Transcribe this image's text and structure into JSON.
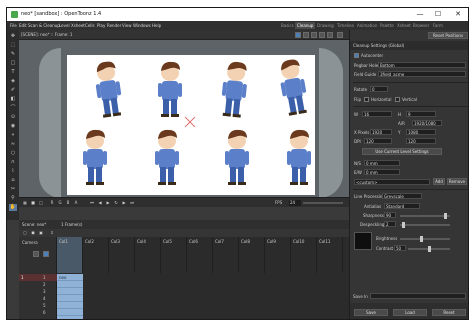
{
  "window": {
    "title": "neo* [sandbox] : OpenToonz 1.4",
    "min_glyph": "—",
    "max_glyph": "☐",
    "close_glyph": "✕"
  },
  "menubar": {
    "items": [
      "File",
      "Edit",
      "Scan & Cleanup",
      "Level",
      "Xsheet",
      "Cells",
      "Play",
      "Render",
      "View",
      "Windows",
      "Help"
    ],
    "rooms": [
      "Basics",
      "Cleanup",
      "Drawing",
      "Timeline",
      "Animation",
      "Palette",
      "Xsheet",
      "Browser",
      "Farm"
    ],
    "active_room": "Cleanup",
    "reset_label": "Reset Positions"
  },
  "viewer": {
    "tab": "[SCENE]: neo* :: Frame: 1",
    "level_label": "neo"
  },
  "frame_controls": {
    "fps_label": "FPS",
    "fps_value": "24"
  },
  "xsheet": {
    "tab": "Scene: neo*",
    "frame_label": "1 Frame(s)",
    "columns": [
      "Col1",
      "Col2",
      "Col3",
      "Col4",
      "Col5",
      "Col6",
      "Col7",
      "Col8",
      "Col9",
      "Col10",
      "Col11"
    ],
    "rows": [
      "1",
      "2",
      "3",
      "4",
      "5",
      "6",
      "7"
    ],
    "camera_label": "Camera"
  },
  "cleanup": {
    "title": "Cleanup Settings (Global)",
    "autocenter_label": "Autocenter",
    "autocenter_checked": true,
    "pegbar_holes_label": "Pegbar Holes",
    "pegbar_holes_value": "Bottom",
    "field_guide_label": "Field Guide",
    "field_guide_value": "3field_acme",
    "rotate_label": "Rotate",
    "rotate_value": "0",
    "flip_label": "Flip",
    "horizontal_label": "Horizontal",
    "vertical_label": "Vertical",
    "width_label": "W",
    "width_value": "16",
    "height_label": "H",
    "height_value": "9",
    "ratio_label": "A/R",
    "ratio_value": "1920/1080",
    "xpx_label": "X Pixels",
    "xpx_value": "1920",
    "ypx_label": "Y",
    "ypx_value": "1080",
    "dpi_label": "DPI",
    "dpi_value": "120",
    "dpi2_value": "120",
    "use_current_level": "Use Current Level Settings",
    "nx_label": "N/S",
    "nx_value": "0 mm",
    "ew_label": "E/W",
    "ew_value": "0 mm",
    "dest_value": "<custom>",
    "add_label": "Add",
    "remove_label": "Remove",
    "line_processing_label": "Line Processing",
    "line_processing_value": "Greyscale",
    "antialias_label": "Antialias",
    "antialias_value": "Standard",
    "sharpness_label": "Sharpness",
    "sharpness_value": "90",
    "despeckling_label": "Despeckling",
    "despeckling_value": "2",
    "brightness_label": "Brightness",
    "contrast_label": "Contrast",
    "contrast_value": "50",
    "save_in_label": "Save In",
    "save_label": "Save",
    "load_label": "Load",
    "reset_label": "Reset"
  },
  "colors": {
    "accent": "#4b7fb8",
    "level_cell": "#8fb2d6",
    "character_shirt": "#5b7fc8",
    "character_hair": "#6b3a1e",
    "character_skin": "#f3d2b3"
  }
}
